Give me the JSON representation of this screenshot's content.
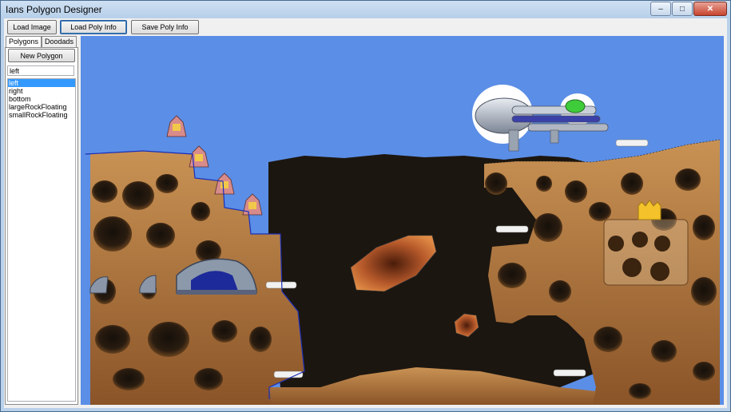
{
  "window": {
    "title": "Ians Polygon Designer",
    "minimize_glyph": "–",
    "maximize_glyph": "□",
    "close_glyph": "✕"
  },
  "toolbar": {
    "load_image": "Load Image",
    "load_poly_info": "Load Poly Info",
    "save_poly_info": "Save Poly Info"
  },
  "tabs": [
    {
      "label": "Polygons"
    },
    {
      "label": "Doodads"
    }
  ],
  "polygons_panel": {
    "new_polygon_label": "New Polygon",
    "name_value": "left",
    "items": [
      {
        "label": "left"
      },
      {
        "label": "right"
      },
      {
        "label": "bottom"
      },
      {
        "label": "largeRockFloating"
      },
      {
        "label": "smallRockFloating"
      }
    ],
    "selected": "left"
  },
  "colors": {
    "sky": "#5b8ee6",
    "rock": "#b57a3a",
    "cave": "#1c1610",
    "selection": "#3399ff"
  }
}
